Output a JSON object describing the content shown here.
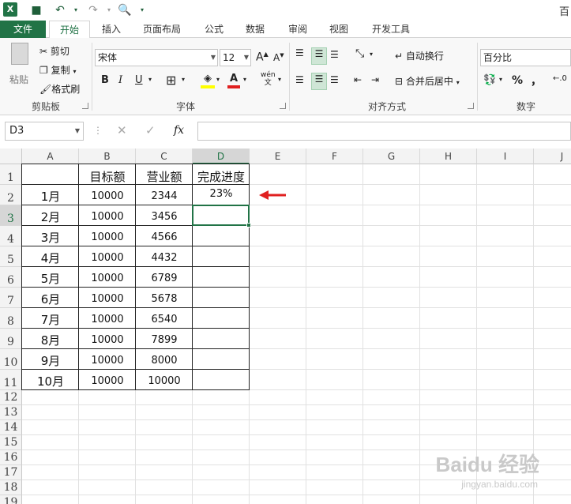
{
  "app": {
    "title_fragment": "百",
    "logo": "excel-icon"
  },
  "tabs": [
    "文件",
    "开始",
    "插入",
    "页面布局",
    "公式",
    "数据",
    "审阅",
    "视图",
    "开发工具"
  ],
  "ribbon": {
    "clipboard": {
      "paste": "粘贴",
      "cut": "剪切",
      "copy": "复制",
      "format_painter": "格式刷",
      "label": "剪贴板"
    },
    "font": {
      "name": "宋体",
      "size": "12",
      "bold": "B",
      "italic": "I",
      "underline": "U",
      "phonetic": "wén",
      "label": "字体"
    },
    "alignment": {
      "wrap": "自动换行",
      "merge": "合并后居中",
      "label": "对齐方式"
    },
    "number": {
      "format": "百分比",
      "percent": "%",
      "comma": "，",
      "label": "数字"
    }
  },
  "formula_bar": {
    "name_box": "D3",
    "fx": "fx",
    "value": ""
  },
  "sheet": {
    "columns": [
      "A",
      "B",
      "C",
      "D",
      "E",
      "F",
      "G",
      "H",
      "I",
      "J"
    ],
    "rows": [
      "1",
      "2",
      "3",
      "4",
      "5",
      "6",
      "7",
      "8",
      "9",
      "10",
      "11",
      "12",
      "13",
      "14",
      "15",
      "16",
      "17",
      "18",
      "19"
    ],
    "selected_cell": "D3",
    "header": [
      "",
      "目标额",
      "营业额",
      "完成进度"
    ],
    "data": [
      [
        "1月",
        "10000",
        "2344",
        "23%"
      ],
      [
        "2月",
        "10000",
        "3456",
        ""
      ],
      [
        "3月",
        "10000",
        "4566",
        ""
      ],
      [
        "4月",
        "10000",
        "4432",
        ""
      ],
      [
        "5月",
        "10000",
        "6789",
        ""
      ],
      [
        "6月",
        "10000",
        "5678",
        ""
      ],
      [
        "7月",
        "10000",
        "6540",
        ""
      ],
      [
        "8月",
        "10000",
        "7899",
        ""
      ],
      [
        "9月",
        "10000",
        "8000",
        ""
      ],
      [
        "10月",
        "10000",
        "10000",
        ""
      ]
    ],
    "arrow_color": "#e02020",
    "accent": "#217346"
  },
  "watermark": {
    "brand": "Baidu 经验",
    "url": "jingyan.baidu.com"
  }
}
